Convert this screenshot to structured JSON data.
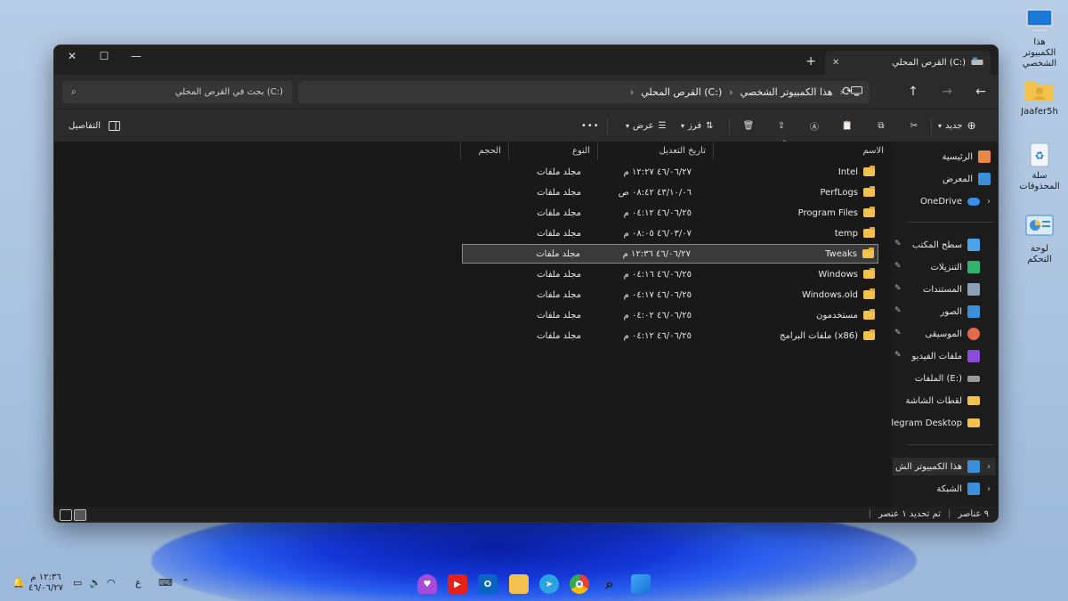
{
  "window": {
    "tab_title": "القرص المحلي (C:)",
    "new_tab": "+",
    "close_tab": "✕"
  },
  "address": {
    "crumbs": [
      "هذا الكمبيوتر الشخصي",
      "القرص المحلي (C:)"
    ],
    "search_placeholder": "بحث في القرص المحلي (C:)"
  },
  "toolbar": {
    "new_label": "جديد",
    "sort_label": "فرز",
    "view_label": "عرض",
    "more_label": "•••",
    "details_label": "التفاصيل"
  },
  "sidebar": {
    "top": [
      {
        "label": "الرئيسية",
        "icon": "home-icon",
        "color": "#e8884a"
      },
      {
        "label": "المعرض",
        "icon": "gallery-icon",
        "color": "#3b8fd8"
      },
      {
        "label": "OneDrive",
        "icon": "cloud-icon",
        "color": "#3a8ee6"
      }
    ],
    "quick": [
      {
        "label": "سطح المكتب",
        "icon": "desktop-icon",
        "color": "#4aa3e8"
      },
      {
        "label": "التنزيلات",
        "icon": "download-icon",
        "color": "#2fb36b"
      },
      {
        "label": "المستندات",
        "icon": "documents-icon",
        "color": "#8b9fb8"
      },
      {
        "label": "الصور",
        "icon": "pictures-icon",
        "color": "#3b8fd8"
      },
      {
        "label": "الموسيقى",
        "icon": "music-icon",
        "color": "#e06a4a"
      },
      {
        "label": "ملفات الفيديو",
        "icon": "video-icon",
        "color": "#8a4ad8"
      },
      {
        "label": "الملفات (E:)",
        "icon": "drive-icon",
        "color": "#9a9a9a"
      },
      {
        "label": "لقطات الشاشة",
        "icon": "folder-icon",
        "color": "#f2c14e"
      },
      {
        "label": "legram Desktop",
        "icon": "folder-icon",
        "color": "#f2c14e"
      }
    ],
    "bottom": [
      {
        "label": "هذا الكمبيوتر الش",
        "icon": "pc-icon",
        "color": "#3b8fd8"
      },
      {
        "label": "الشبكة",
        "icon": "network-icon",
        "color": "#3b8fd8"
      }
    ]
  },
  "columns": {
    "name": "الاسم",
    "date": "تاريخ التعديل",
    "type": "النوع",
    "size": "الحجم"
  },
  "files": [
    {
      "name": "Intel",
      "date": "٤٦/٠٦/٢٧ ١٢:٢٧ م",
      "type": "مجلد ملفات"
    },
    {
      "name": "PerfLogs",
      "date": "٤٣/١٠/٠٦ ٠٨:٤٢ ص",
      "type": "مجلد ملفات"
    },
    {
      "name": "Program Files",
      "date": "٤٦/٠٦/٢٥ ٠٤:١٢ م",
      "type": "مجلد ملفات"
    },
    {
      "name": "temp",
      "date": "٤٦/٠٣/٠٧ ٠٨:٠٥ م",
      "type": "مجلد ملفات"
    },
    {
      "name": "Tweaks",
      "date": "٤٦/٠٦/٢٧ ١٢:٣٦ م",
      "type": "مجلد ملفات"
    },
    {
      "name": "Windows",
      "date": "٤٦/٠٦/٢٥ ٠٤:١٦ م",
      "type": "مجلد ملفات"
    },
    {
      "name": "Windows.old",
      "date": "٤٦/٠٦/٢٥ ٠٤:١٧ م",
      "type": "مجلد ملفات"
    },
    {
      "name": "مستخدمون",
      "date": "٤٦/٠٦/٢٥ ٠٤:٠٢ م",
      "type": "مجلد ملفات"
    },
    {
      "name": "ملفات البرامج (x86)",
      "date": "٤٦/٠٦/٢٥ ٠٤:١٢ م",
      "type": "مجلد ملفات"
    }
  ],
  "status": {
    "count": "٩ عناصر",
    "selected": "تم تحديد ١ عنصر"
  },
  "desktop": [
    {
      "label": "هذا الكمبيوتر الشخصي",
      "icon": "monitor-icon"
    },
    {
      "label": "Jaafer5h",
      "icon": "user-folder-icon"
    },
    {
      "label": "سلة المحذوفات",
      "icon": "recycle-bin-icon"
    },
    {
      "label": "لوحة التحكم",
      "icon": "control-panel-icon"
    }
  ],
  "taskbar": {
    "time": "١٢:٣٦ م",
    "date": "٤٦/٠٦/٢٧",
    "lang": "ع",
    "apps": [
      "heart-app-icon",
      "youtube-icon",
      "outlook-icon",
      "file-explorer-icon",
      "telegram-icon",
      "chrome-icon",
      "search-icon",
      "start-icon"
    ]
  }
}
